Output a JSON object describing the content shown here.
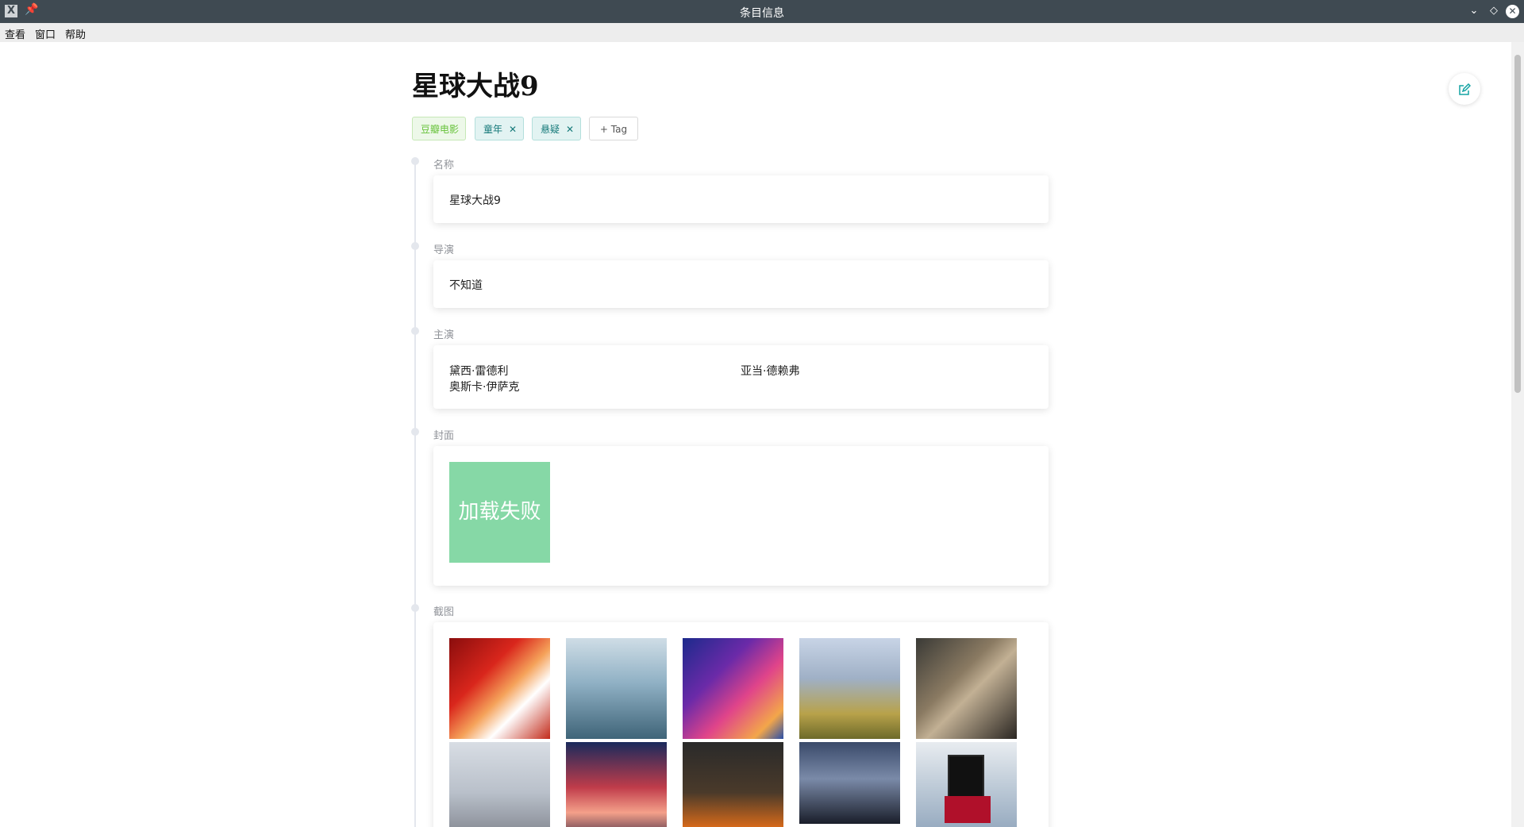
{
  "window": {
    "title": "条目信息"
  },
  "menu": {
    "view": "查看",
    "window": "窗口",
    "help": "帮助"
  },
  "page": {
    "title": "星球大战9"
  },
  "tags": {
    "items": [
      {
        "label": "豆瓣电影",
        "color": "#67c23a"
      },
      {
        "label": "童年",
        "color": "#167a7a"
      },
      {
        "label": "悬疑",
        "color": "#167a7a"
      }
    ],
    "add_label": "+ Tag"
  },
  "fields": {
    "name": {
      "label": "名称",
      "value": "星球大战9"
    },
    "director": {
      "label": "导演",
      "value": "不知道"
    },
    "cast": {
      "label": "主演",
      "values": [
        "黛西·雷德利",
        "亚当·德赖弗",
        "奥斯卡·伊萨克"
      ]
    },
    "cover": {
      "label": "封面",
      "fail_text": "加载失败"
    },
    "screenshots": {
      "label": "截图"
    }
  },
  "icons": {
    "app": "x-app-icon",
    "pin": "pin-icon",
    "edit": "edit-icon"
  },
  "colors": {
    "accent": "#13a3a3",
    "titlebar": "#3f4a52"
  }
}
